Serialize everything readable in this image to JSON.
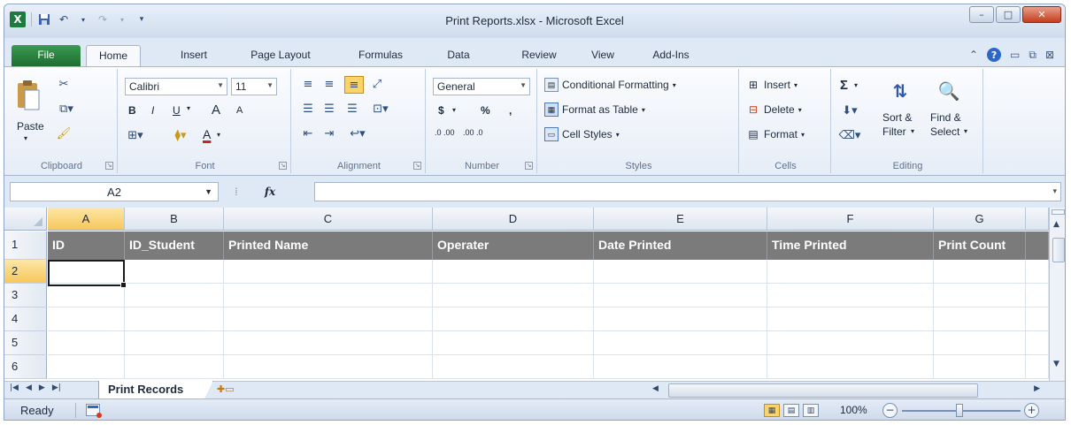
{
  "window": {
    "title": "Print Reports.xlsx - Microsoft Excel",
    "logo": "X",
    "controls": {
      "minimize": "–",
      "maximize": "□",
      "close": "✕"
    }
  },
  "ribbon_tabs": [
    "File",
    "Home",
    "Insert",
    "Page Layout",
    "Formulas",
    "Data",
    "Review",
    "View",
    "Add-Ins"
  ],
  "ribbon": {
    "clipboard": {
      "label": "Clipboard",
      "paste": "Paste"
    },
    "font": {
      "label": "Font",
      "name": "Calibri",
      "size": "11",
      "bold": "B",
      "italic": "I",
      "underline": "U",
      "grow": "A",
      "shrink": "A",
      "color": "A"
    },
    "alignment": {
      "label": "Alignment"
    },
    "number": {
      "label": "Number",
      "format": "General",
      "currency": "$",
      "percent": "%",
      "comma": ",",
      "inc": ".0 .00",
      "dec": ".00 .0"
    },
    "styles": {
      "label": "Styles",
      "conditional": "Conditional Formatting",
      "format_table": "Format as Table",
      "cell_styles": "Cell Styles"
    },
    "cells": {
      "label": "Cells",
      "insert": "Insert",
      "delete": "Delete",
      "format": "Format"
    },
    "editing": {
      "label": "Editing",
      "sum": "Σ",
      "sort": "Sort & Filter",
      "find": "Find & Select",
      "sort_l1": "Sort &",
      "sort_l2": "Filter",
      "find_l1": "Find &",
      "find_l2": "Select"
    }
  },
  "formula_bar": {
    "name_box": "A2",
    "fx": "fx",
    "value": ""
  },
  "columns": [
    "A",
    "B",
    "C",
    "D",
    "E",
    "F",
    "G"
  ],
  "rows": [
    "1",
    "2",
    "3",
    "4",
    "5",
    "6"
  ],
  "headers": [
    "ID",
    "ID_Student",
    "Printed Name",
    "Operater",
    "Date Printed",
    "Time Printed",
    "Print Count"
  ],
  "sheets": [
    "Print Records"
  ],
  "status": {
    "ready": "Ready",
    "zoom": "100%"
  },
  "colors": {
    "header_fill": "#7b7b7b",
    "selected_header": "#f6c75a",
    "file_tab": "#1e6d31"
  },
  "icons": [
    "excel-logo-icon",
    "save-icon",
    "undo-icon",
    "redo-icon",
    "paste-icon",
    "cut-icon",
    "copy-icon",
    "format-painter-icon",
    "help-icon"
  ]
}
